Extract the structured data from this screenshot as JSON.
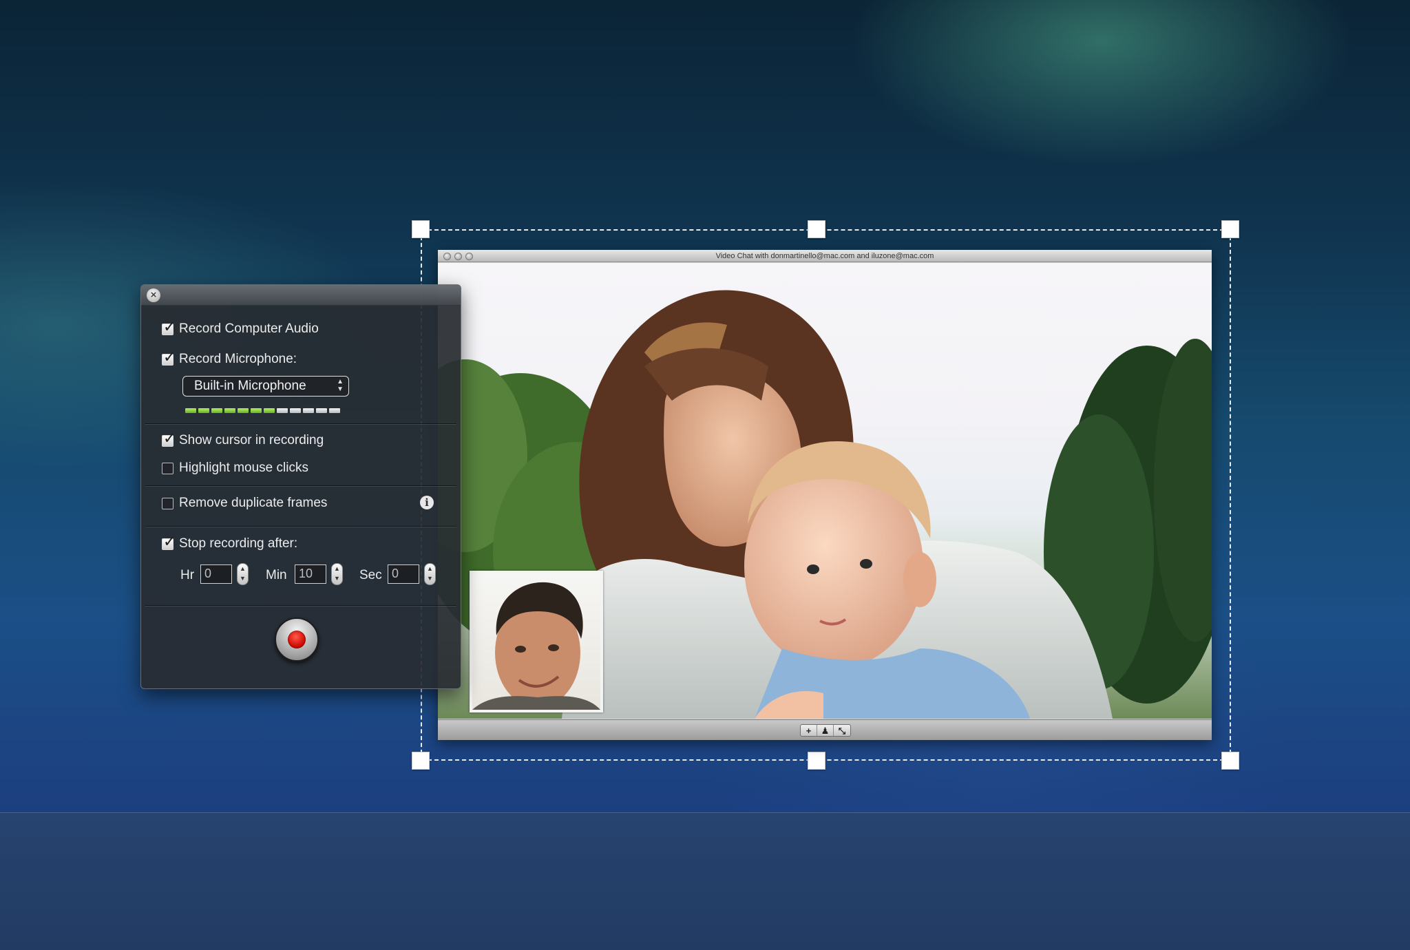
{
  "colors": {
    "record": "#d10e05",
    "meter_on": "#7ac238",
    "meter_off": "#d8d8d8",
    "panel_bg": "#2b2e33"
  },
  "panel": {
    "close_icon": "close-icon",
    "record_computer_audio": {
      "label": "Record Computer Audio",
      "checked": true
    },
    "record_microphone": {
      "label": "Record Microphone:",
      "checked": true
    },
    "microphone_select": {
      "value": "Built-in Microphone",
      "icon": "up-down-arrows-icon"
    },
    "level_meter": {
      "segments": 12,
      "active": 7
    },
    "show_cursor": {
      "label": "Show cursor in recording",
      "checked": true
    },
    "highlight_clicks": {
      "label": "Highlight mouse clicks",
      "checked": false
    },
    "remove_duplicates": {
      "label": "Remove duplicate frames",
      "checked": false,
      "info_icon": "info-icon",
      "info_glyph": "i"
    },
    "stop_recording": {
      "label": "Stop recording after:",
      "checked": true
    },
    "time": {
      "hr_label": "Hr",
      "hr_value": "0",
      "min_label": "Min",
      "min_value": "10",
      "sec_label": "Sec",
      "sec_value": "0"
    },
    "record_button_icon": "record-icon"
  },
  "video_window": {
    "title": "Video Chat with donmartinello@mac.com and iluzone@mac.com",
    "controls": [
      "+",
      "♟",
      "⤡"
    ]
  }
}
